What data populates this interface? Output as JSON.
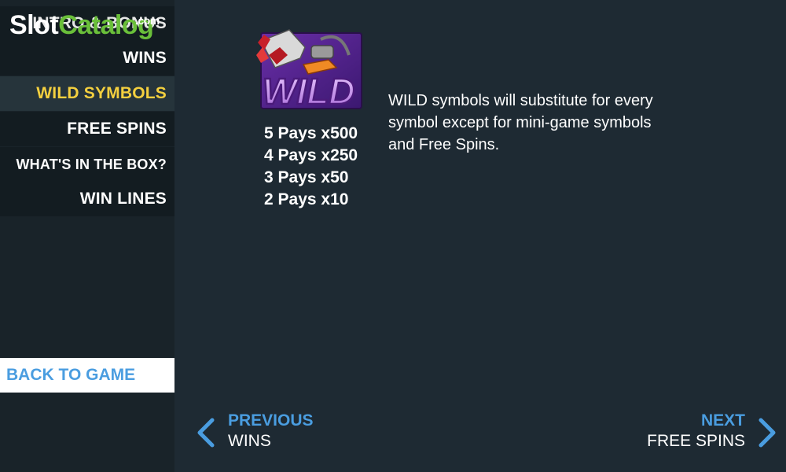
{
  "menu": {
    "items": [
      {
        "label": "INTRO & BONUS"
      },
      {
        "label": "WINS"
      },
      {
        "label": "WILD SYMBOLS"
      },
      {
        "label": "FREE SPINS"
      },
      {
        "label": "WHAT'S IN THE BOX?"
      },
      {
        "label": "WIN LINES"
      }
    ],
    "active_index": 2,
    "back_label": "BACK TO GAME"
  },
  "watermark": {
    "part1": "Slot",
    "part2": "Catalog",
    "suffix": ".com"
  },
  "symbol": {
    "name": "WILD",
    "icon": "chainsaw-wild-icon"
  },
  "paytable": [
    "5 Pays x500",
    "4 Pays x250",
    "3 Pays x50",
    "2 Pays x10"
  ],
  "description": "WILD symbols will substitute for every symbol except for mini-game symbols and Free Spins.",
  "nav": {
    "prev": {
      "title": "PREVIOUS",
      "target": "WINS"
    },
    "next": {
      "title": "NEXT",
      "target": "FREE SPINS"
    }
  },
  "colors": {
    "accent": "#4a9de0",
    "active": "#f4d03f",
    "background": "#1e2a33"
  }
}
